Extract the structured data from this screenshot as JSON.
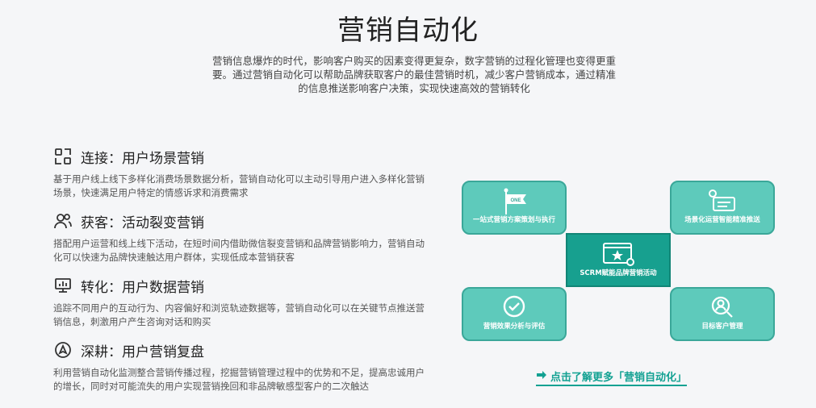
{
  "header": {
    "title": "营销自动化",
    "intro": "营销信息爆炸的时代，影响客户购买的因素变得更复杂，数字营销的过程化管理也变得更重要。通过营销自动化可以帮助品牌获取客户的最佳营销时机，减少客户营销成本，通过精准的信息推送影响客户决策，实现快速高效的营销转化"
  },
  "features": [
    {
      "title": "连接：用户场景营销",
      "desc": "基于用户线上线下多样化消费场景数据分析，营销自动化可以主动引导用户进入多样化营销场景，快速满足用户特定的情感诉求和消费需求",
      "icon": "scan-icon"
    },
    {
      "title": "获客：活动裂变营销",
      "desc": "搭配用户运营和线上线下活动，在短时间内借助微信裂变营销和品牌营销影响力，营销自动化可以快速为品牌快速触达用户群体，实现低成本营销获客",
      "icon": "users-icon"
    },
    {
      "title": "转化：用户数据营销",
      "desc": "追踪不同用户的互动行为、内容偏好和浏览轨迹数据等，营销自动化可以在关键节点推送营销信息，刺激用户产生咨询对话和购买",
      "icon": "monitor-chart-icon"
    },
    {
      "title": "深耕：用户营销复盘",
      "desc": "利用营销自动化监测整合营销传播过程，挖掘营销管理过程中的优势和不足，提高忠诚用户的增长，同时对可能流失的用户实现营销挽回和非品牌敏感型客户的二次触达",
      "icon": "compass-icon"
    }
  ],
  "diagram": {
    "top_left": "一站式营销方案策划与执行",
    "top_left_flag": "ONE",
    "top_right": "场景化运营智能精准推送",
    "center": "SCRM赋能品牌营销活动",
    "bottom_left": "营销效果分析与评估",
    "bottom_right": "目标客户管理"
  },
  "cta": {
    "label": "点击了解更多「营销自动化」"
  },
  "colors": {
    "accent": "#12a192",
    "card": "#5ecabb",
    "center": "#17a08f"
  }
}
